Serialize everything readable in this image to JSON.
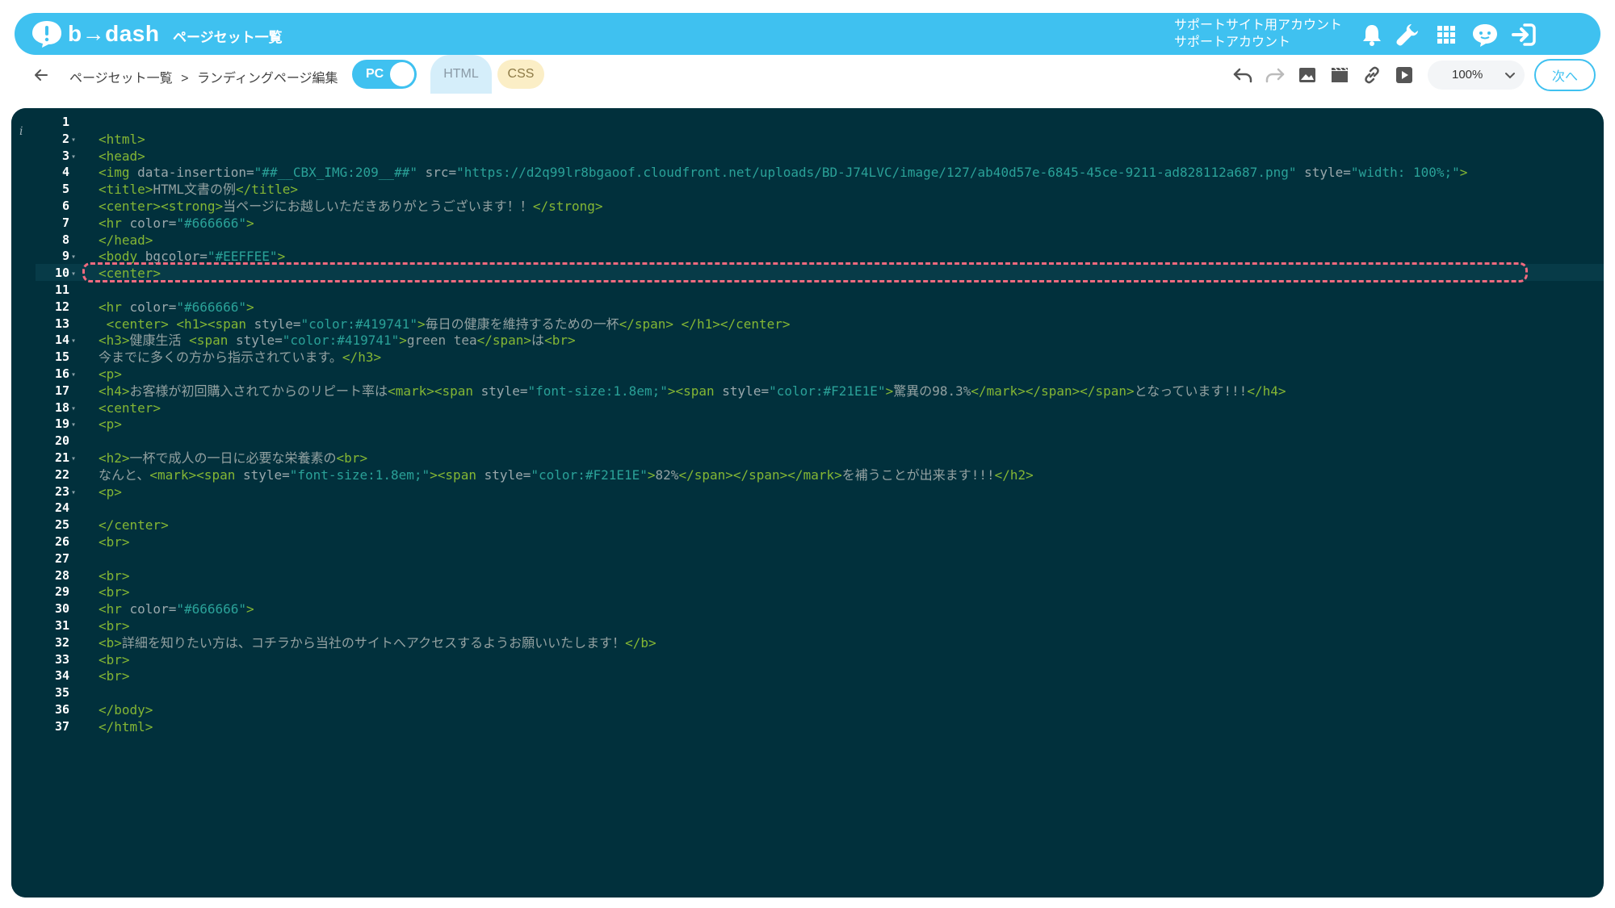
{
  "app": {
    "logo_text": "b→dash",
    "page_label": "ページセット一覧",
    "account_line1": "サポートサイト用アカウント",
    "account_line2": "サポートアカウント"
  },
  "toolbar": {
    "breadcrumb": [
      "ページセット一覧",
      ">",
      "ランディングページ編集"
    ],
    "device_toggle": "PC",
    "tab_html": "HTML",
    "tab_css": "CSS",
    "zoom": "100%",
    "next_label": "次へ"
  },
  "icons": {
    "top": [
      "bell-icon",
      "wrench-icon",
      "grid-icon",
      "chat-face-icon",
      "logout-icon"
    ],
    "tools": [
      "undo-icon",
      "redo-icon",
      "image-icon",
      "video-icon",
      "link-icon",
      "play-icon"
    ]
  },
  "colors": {
    "brand": "#3fc1f0",
    "editor_bg": "#01303c",
    "tag": "#84b634",
    "string": "#2aa198",
    "highlight": "#f26a7f"
  },
  "editor": {
    "active_line": 4,
    "lines": [
      {
        "n": "1",
        "fold": false,
        "segs": []
      },
      {
        "n": "2",
        "fold": true,
        "segs": [
          [
            "tag",
            "<html>"
          ]
        ]
      },
      {
        "n": "3",
        "fold": true,
        "segs": [
          [
            "tag",
            "<head>"
          ]
        ]
      },
      {
        "n": "4",
        "fold": false,
        "segs": [
          [
            "tag",
            "<img "
          ],
          [
            "attr",
            "data-insertion="
          ],
          [
            "str",
            "\"##__CBX_IMG:209__##\""
          ],
          [
            "attr",
            " src="
          ],
          [
            "str",
            "\"https://d2q99lr8bgaoof.cloudfront.net/uploads/BD-J74LVC/image/127/ab40d57e-6845-45ce-9211-ad828112a687.png\""
          ],
          [
            "attr",
            " style="
          ],
          [
            "str",
            "\"width: 100%;\""
          ],
          [
            "tag",
            ">"
          ]
        ]
      },
      {
        "n": "5",
        "fold": false,
        "segs": [
          [
            "tag",
            "<title>"
          ],
          [
            "txt",
            "HTML文書の例"
          ],
          [
            "tag",
            "</title>"
          ]
        ]
      },
      {
        "n": "6",
        "fold": false,
        "segs": [
          [
            "tag",
            "<center><strong>"
          ],
          [
            "txt",
            "当ページにお越しいただきありがとうございます！！"
          ],
          [
            "tag",
            "</strong>"
          ]
        ]
      },
      {
        "n": "7",
        "fold": false,
        "segs": [
          [
            "tag",
            "<hr "
          ],
          [
            "attr",
            "color="
          ],
          [
            "str",
            "\"#666666\""
          ],
          [
            "tag",
            ">"
          ]
        ]
      },
      {
        "n": "8",
        "fold": false,
        "segs": [
          [
            "tag",
            "</head>"
          ]
        ]
      },
      {
        "n": "9",
        "fold": true,
        "segs": [
          [
            "tag",
            "<body "
          ],
          [
            "attr",
            "bgcolor="
          ],
          [
            "str",
            "\"#EEFFEE\""
          ],
          [
            "tag",
            ">"
          ]
        ]
      },
      {
        "n": "10",
        "fold": true,
        "segs": [
          [
            "tag",
            "<center>"
          ]
        ]
      },
      {
        "n": "11",
        "fold": false,
        "segs": []
      },
      {
        "n": "12",
        "fold": false,
        "segs": [
          [
            "tag",
            "<hr "
          ],
          [
            "attr",
            "color="
          ],
          [
            "str",
            "\"#666666\""
          ],
          [
            "tag",
            ">"
          ]
        ]
      },
      {
        "n": "13",
        "fold": false,
        "segs": [
          [
            "tag",
            " <center> <h1><span "
          ],
          [
            "attr",
            "style="
          ],
          [
            "str",
            "\"color:#419741\""
          ],
          [
            "tag",
            ">"
          ],
          [
            "txt",
            "毎日の健康を維持するための一杯"
          ],
          [
            "tag",
            "</span> </h1></center>"
          ]
        ]
      },
      {
        "n": "14",
        "fold": true,
        "segs": [
          [
            "tag",
            "<h3>"
          ],
          [
            "txt",
            "健康生活 "
          ],
          [
            "tag",
            "<span "
          ],
          [
            "attr",
            "style="
          ],
          [
            "str",
            "\"color:#419741\""
          ],
          [
            "tag",
            ">"
          ],
          [
            "txt",
            "green tea"
          ],
          [
            "tag",
            "</span>"
          ],
          [
            "txt",
            "は"
          ],
          [
            "tag",
            "<br>"
          ]
        ]
      },
      {
        "n": "15",
        "fold": false,
        "segs": [
          [
            "txt",
            "今までに多くの方から指示されています。"
          ],
          [
            "tag",
            "</h3>"
          ]
        ]
      },
      {
        "n": "16",
        "fold": true,
        "segs": [
          [
            "tag",
            "<p>"
          ]
        ]
      },
      {
        "n": "17",
        "fold": false,
        "segs": [
          [
            "tag",
            "<h4>"
          ],
          [
            "txt",
            "お客様が初回購入されてからのリピート率は"
          ],
          [
            "tag",
            "<mark><span "
          ],
          [
            "attr",
            "style="
          ],
          [
            "str",
            "\"font-size:1.8em;\""
          ],
          [
            "tag",
            "><span "
          ],
          [
            "attr",
            "style="
          ],
          [
            "str",
            "\"color:#F21E1E\""
          ],
          [
            "tag",
            ">"
          ],
          [
            "txt",
            "驚異の98.3%"
          ],
          [
            "tag",
            "</mark></span></span>"
          ],
          [
            "txt",
            "となっています!!!"
          ],
          [
            "tag",
            "</h4>"
          ]
        ]
      },
      {
        "n": "18",
        "fold": true,
        "segs": [
          [
            "tag",
            "<center>"
          ]
        ]
      },
      {
        "n": "19",
        "fold": true,
        "segs": [
          [
            "tag",
            "<p>"
          ]
        ]
      },
      {
        "n": "20",
        "fold": false,
        "segs": []
      },
      {
        "n": "21",
        "fold": true,
        "segs": [
          [
            "tag",
            "<h2>"
          ],
          [
            "txt",
            "一杯で成人の一日に必要な栄養素の"
          ],
          [
            "tag",
            "<br>"
          ]
        ]
      },
      {
        "n": "22",
        "fold": false,
        "segs": [
          [
            "txt",
            "なんと、"
          ],
          [
            "tag",
            "<mark><span "
          ],
          [
            "attr",
            "style="
          ],
          [
            "str",
            "\"font-size:1.8em;\""
          ],
          [
            "tag",
            "><span "
          ],
          [
            "attr",
            "style="
          ],
          [
            "str",
            "\"color:#F21E1E\""
          ],
          [
            "tag",
            ">"
          ],
          [
            "txt",
            "82%"
          ],
          [
            "tag",
            "</span></span></mark>"
          ],
          [
            "txt",
            "を補うことが出来ます!!!"
          ],
          [
            "tag",
            "</h2>"
          ]
        ]
      },
      {
        "n": "23",
        "fold": true,
        "segs": [
          [
            "tag",
            "<p>"
          ]
        ]
      },
      {
        "n": "24",
        "fold": false,
        "segs": []
      },
      {
        "n": "25",
        "fold": false,
        "segs": [
          [
            "tag",
            "</center>"
          ]
        ]
      },
      {
        "n": "26",
        "fold": false,
        "segs": [
          [
            "tag",
            "<br>"
          ]
        ]
      },
      {
        "n": "27",
        "fold": false,
        "segs": []
      },
      {
        "n": "28",
        "fold": false,
        "segs": [
          [
            "tag",
            "<br>"
          ]
        ]
      },
      {
        "n": "29",
        "fold": false,
        "segs": [
          [
            "tag",
            "<br>"
          ]
        ]
      },
      {
        "n": "30",
        "fold": false,
        "segs": [
          [
            "tag",
            "<hr "
          ],
          [
            "attr",
            "color="
          ],
          [
            "str",
            "\"#666666\""
          ],
          [
            "tag",
            ">"
          ]
        ]
      },
      {
        "n": "31",
        "fold": false,
        "segs": [
          [
            "tag",
            "<br>"
          ]
        ]
      },
      {
        "n": "32",
        "fold": false,
        "segs": [
          [
            "tag",
            "<b>"
          ],
          [
            "txt",
            "詳細を知りたい方は、コチラから当社のサイトへアクセスするようお願いいたします！"
          ],
          [
            "tag",
            "</b>"
          ]
        ]
      },
      {
        "n": "33",
        "fold": false,
        "segs": [
          [
            "tag",
            "<br>"
          ]
        ]
      },
      {
        "n": "34",
        "fold": false,
        "segs": [
          [
            "tag",
            "<br>"
          ]
        ]
      },
      {
        "n": "35",
        "fold": false,
        "segs": []
      },
      {
        "n": "36",
        "fold": false,
        "segs": [
          [
            "tag",
            "</body>"
          ]
        ]
      },
      {
        "n": "37",
        "fold": false,
        "segs": [
          [
            "tag",
            "</html>"
          ]
        ]
      }
    ]
  }
}
